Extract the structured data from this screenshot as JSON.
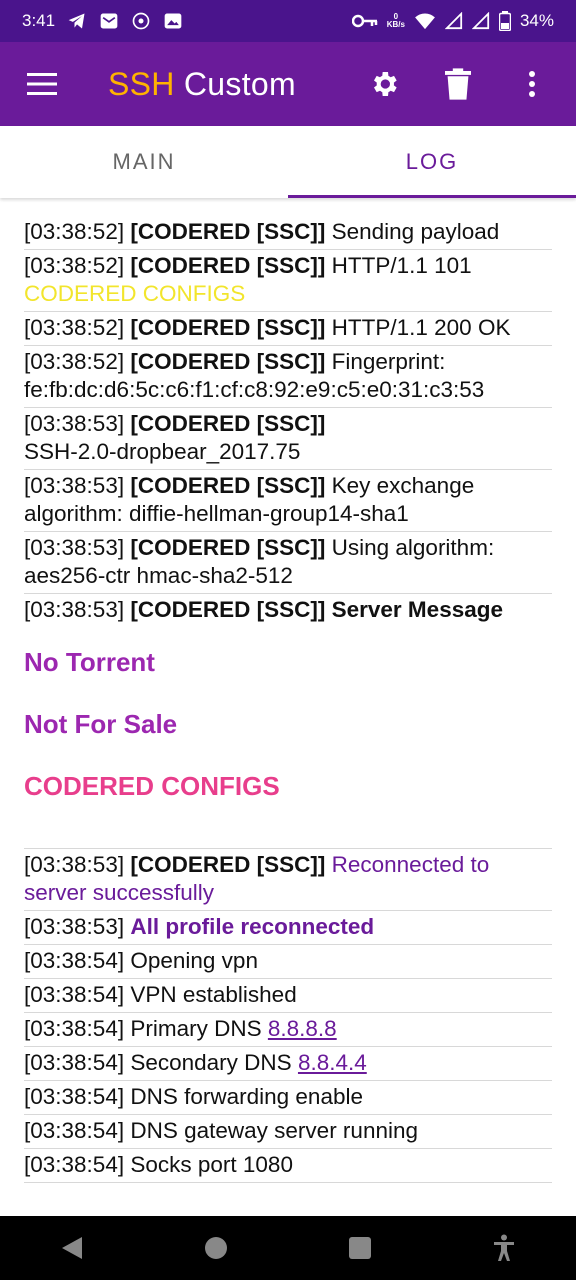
{
  "status_bar": {
    "time": "3:41",
    "net_speed_value": "0",
    "net_speed_unit": "KB/s",
    "battery": "34%",
    "icons": [
      "telegram-icon",
      "mail-icon",
      "app-icon",
      "gallery-icon",
      "key-icon",
      "wifi-icon",
      "signal-icon",
      "signal-icon",
      "battery-icon"
    ]
  },
  "app_bar": {
    "title_accent": "SSH",
    "title_rest": " Custom",
    "accent_color": "#ffb300",
    "bar_color": "#6a1b9a"
  },
  "tabs": [
    {
      "label": "MAIN",
      "active": false
    },
    {
      "label": "LOG",
      "active": true
    }
  ],
  "log": {
    "e1": {
      "time": "[03:38:52]",
      "tag": "[CODERED [SSC]]",
      "text": "Sending payload"
    },
    "e2": {
      "time": "[03:38:52]",
      "tag": "[CODERED [SSC]]",
      "text": "HTTP/1.1 101",
      "extra": "CODERED CONFIGS"
    },
    "e3": {
      "time": "[03:38:52]",
      "tag": "[CODERED [SSC]]",
      "text": "HTTP/1.1 200 OK"
    },
    "e4": {
      "time": "[03:38:52]",
      "tag": "[CODERED [SSC]]",
      "text": "Fingerprint:",
      "extra": "fe:fb:dc:d6:5c:c6:f1:cf:c8:92:e9:c5:e0:31:c3:53"
    },
    "e5": {
      "time": "[03:38:53]",
      "tag": "[CODERED [SSC]]",
      "extra": "SSH-2.0-dropbear_2017.75"
    },
    "e6": {
      "time": "[03:38:53]",
      "tag": "[CODERED [SSC]]",
      "text": "Key exchange algorithm: diffie-hellman-group14-sha1"
    },
    "e7": {
      "time": "[03:38:53]",
      "tag": "[CODERED [SSC]]",
      "text": "Using algorithm: aes256-ctr hmac-sha2-512"
    },
    "e8": {
      "time": "[03:38:53]",
      "tag": "[CODERED [SSC]]",
      "text": "Server Message"
    },
    "server_messages": [
      "No Torrent",
      "Not For Sale",
      "CODERED CONFIGS"
    ],
    "e9": {
      "time": "[03:38:53]",
      "tag": "[CODERED [SSC]]",
      "text": "Reconnected to server successfully"
    },
    "e10": {
      "time": "[03:38:53]",
      "text": "All profile reconnected"
    },
    "e11": {
      "time": "[03:38:54]",
      "text": "Opening vpn"
    },
    "e12": {
      "time": "[03:38:54]",
      "text": "VPN established"
    },
    "e13": {
      "time": "[03:38:54]",
      "text": "Primary DNS",
      "link": "8.8.8.8"
    },
    "e14": {
      "time": "[03:38:54]",
      "text": "Secondary DNS",
      "link": "8.8.4.4"
    },
    "e15": {
      "time": "[03:38:54]",
      "text": "DNS forwarding enable"
    },
    "e16": {
      "time": "[03:38:54]",
      "text": "DNS gateway server running"
    },
    "e17": {
      "time": "[03:38:54]",
      "text": "Socks port 1080"
    }
  }
}
